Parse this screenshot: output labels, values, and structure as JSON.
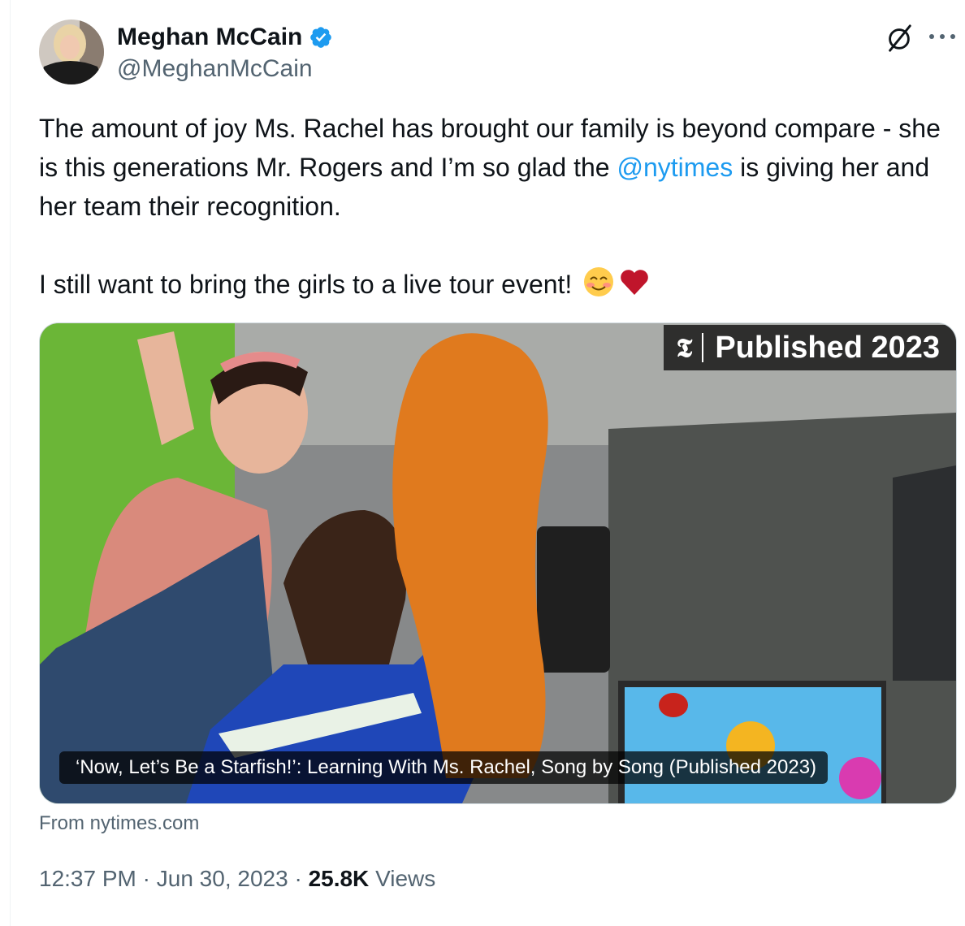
{
  "author": {
    "name": "Meghan McCain",
    "handle": "@MeghanMcCain",
    "verified": true,
    "verified_color": "#1d9bf0"
  },
  "tweet": {
    "line1_part1": "The amount of joy Ms. Rachel has brought our family is beyond compare - she is this generations Mr. Rogers and I’m so glad the ",
    "mention": "@nytimes",
    "line1_part2": " is giving her and her team their recognition.",
    "line2": "I still want to bring the girls to a live tour event!",
    "emojis": [
      "smiling-face-with-smiling-eyes",
      "red-heart"
    ]
  },
  "card": {
    "badge_logo": "𝕿",
    "badge_text": "Published 2023",
    "title": "‘Now, Let’s Be a Starfish!’: Learning With Ms. Rachel, Song by Song (Published 2023)",
    "source": "From nytimes.com"
  },
  "meta": {
    "time": "12:37 PM",
    "separator": "·",
    "date": "Jun 30, 2023",
    "views_count": "25.8K",
    "views_label": "Views"
  },
  "icons": [
    "grok-icon",
    "more-icon",
    "verified-badge-icon"
  ],
  "colors": {
    "link": "#1d9bf0",
    "secondary_text": "#536471",
    "primary_text": "#0f1419"
  }
}
